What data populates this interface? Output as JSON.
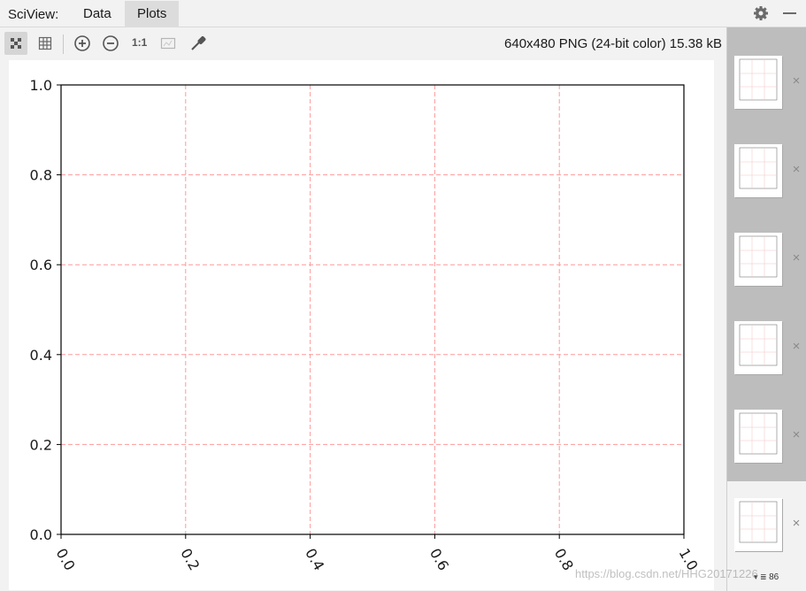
{
  "window": {
    "app_title": "SciView:",
    "tabs": [
      "Data",
      "Plots"
    ],
    "active_tab": "Plots"
  },
  "toolbar": {
    "icons": [
      "grid-toggle-icon",
      "table-grid-icon",
      "zoom-in-icon",
      "zoom-out-icon",
      "actual-size-icon",
      "fit-image-icon",
      "color-picker-icon"
    ],
    "actual_size_label": "1:1",
    "image_info": "640x480 PNG (24-bit color) 15.38 kB"
  },
  "plot": {
    "chart_data": {
      "type": "line",
      "series": [],
      "xlim": [
        0.0,
        1.0
      ],
      "ylim": [
        0.0,
        1.0
      ],
      "x_ticks": [
        "0.0",
        "0.2",
        "0.4",
        "0.6",
        "0.8",
        "1.0"
      ],
      "y_ticks": [
        "0.0",
        "0.2",
        "0.4",
        "0.6",
        "0.8",
        "1.0"
      ],
      "x_tick_rotation": "-60deg",
      "grid": true,
      "grid_color": "#ff9a9a",
      "grid_style": "dashed",
      "axis_color": "#000000"
    }
  },
  "thumbnails": {
    "count": 6,
    "selected_index": 5,
    "close_glyph": "×",
    "page_indicator": "86"
  },
  "watermark": "https://blog.csdn.net/HHG20171226"
}
